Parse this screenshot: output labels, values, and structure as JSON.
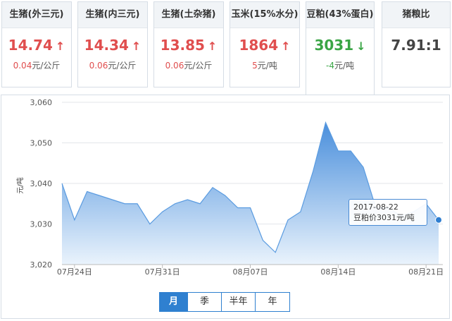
{
  "cards": [
    {
      "title": "生猪(外三元)",
      "price": "14.74",
      "arrow": "↑",
      "dir": "up",
      "change": "0.04",
      "unit": "元/公斤"
    },
    {
      "title": "生猪(内三元)",
      "price": "14.34",
      "arrow": "↑",
      "dir": "up",
      "change": "0.06",
      "unit": "元/公斤"
    },
    {
      "title": "生猪(土杂猪)",
      "price": "13.85",
      "arrow": "↑",
      "dir": "up",
      "change": "0.06",
      "unit": "元/公斤"
    },
    {
      "title": "玉米(15%水分)",
      "price": "1864",
      "arrow": "↑",
      "dir": "up",
      "change": "5",
      "unit": "元/吨"
    },
    {
      "title": "豆粕(43%蛋白)",
      "price": "3031",
      "arrow": "↓",
      "dir": "down",
      "change": "-4",
      "unit": "元/吨"
    },
    {
      "title": "猪粮比",
      "price": "7.91:1",
      "arrow": "",
      "dir": "neutral",
      "change": "",
      "unit": ""
    }
  ],
  "colors": {
    "up": "#e04e4e",
    "down": "#3aa545",
    "accent": "#2f80d0",
    "area_top": "#4a8fdc",
    "area_bottom": "#eaf3fc"
  },
  "tooltip": {
    "date": "2017-08-22",
    "text": "豆粕价3031元/吨"
  },
  "tabs": [
    {
      "label": "月",
      "active": true
    },
    {
      "label": "季",
      "active": false
    },
    {
      "label": "半年",
      "active": false
    },
    {
      "label": "年",
      "active": false
    }
  ],
  "chart_data": {
    "type": "area",
    "ylabel": "元/吨",
    "ylim": [
      3020,
      3060
    ],
    "yticks": [
      "3,060",
      "3,050",
      "3,040",
      "3,030",
      "3,020"
    ],
    "ytick_values": [
      3060,
      3050,
      3040,
      3030,
      3020
    ],
    "xticks": [
      "07月24日",
      "07月31日",
      "08月07日",
      "08月14日",
      "08月21日"
    ],
    "xtick_index": [
      1,
      8,
      15,
      22,
      29
    ],
    "dates": [
      "07-23",
      "07-24",
      "07-25",
      "07-26",
      "07-27",
      "07-28",
      "07-29",
      "07-30",
      "07-31",
      "08-01",
      "08-02",
      "08-03",
      "08-04",
      "08-05",
      "08-06",
      "08-07",
      "08-08",
      "08-09",
      "08-10",
      "08-11",
      "08-12",
      "08-13",
      "08-14",
      "08-15",
      "08-16",
      "08-17",
      "08-18",
      "08-19",
      "08-20",
      "08-21",
      "08-22"
    ],
    "values": [
      3040,
      3031,
      3038,
      3037,
      3036,
      3035,
      3035,
      3030,
      3033,
      3035,
      3036,
      3035,
      3039,
      3037,
      3034,
      3034,
      3026,
      3023,
      3031,
      3033,
      3043,
      3055,
      3048,
      3048,
      3044,
      3034,
      3034,
      3032,
      3033,
      3035,
      3031
    ],
    "highlight_index": 30,
    "grid": true,
    "legend": "none"
  }
}
